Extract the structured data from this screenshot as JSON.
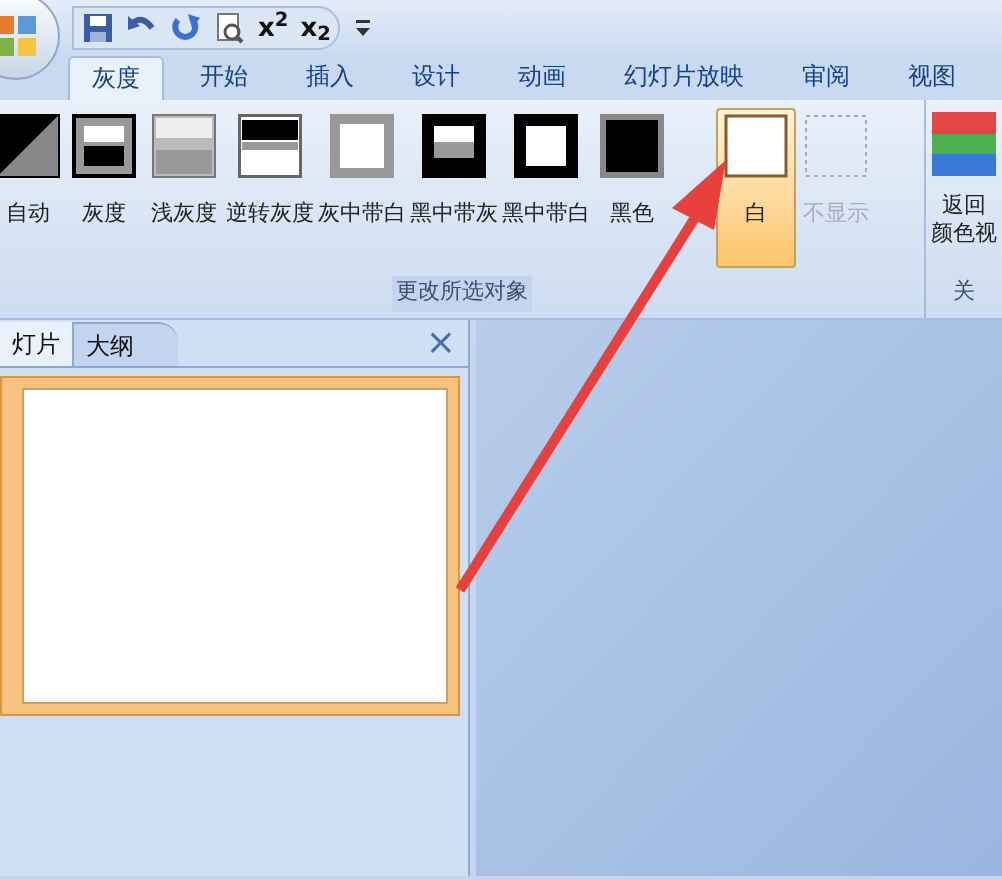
{
  "quick_access": [
    {
      "kind": "save"
    },
    {
      "kind": "undo"
    },
    {
      "kind": "redo"
    },
    {
      "kind": "preview"
    },
    {
      "kind": "text",
      "label": "x$^{2}$"
    },
    {
      "kind": "text",
      "label": "x$_{2}$"
    }
  ],
  "tabs": [
    {
      "label": "灰度",
      "selected": true
    },
    {
      "label": "开始",
      "selected": false
    },
    {
      "label": "插入",
      "selected": false
    },
    {
      "label": "设计",
      "selected": false
    },
    {
      "label": "动画",
      "selected": false
    },
    {
      "label": "幻灯片放映",
      "selected": false
    },
    {
      "label": "审阅",
      "selected": false
    },
    {
      "label": "视图",
      "selected": false
    }
  ],
  "ribbon": {
    "group_label": "更改所选对象",
    "buttons": [
      {
        "kind": "auto",
        "label": "自动",
        "selected": false,
        "disabled": false
      },
      {
        "kind": "grayscale",
        "label": "灰度",
        "selected": false,
        "disabled": false
      },
      {
        "kind": "light",
        "label": "浅灰度",
        "selected": false,
        "disabled": false
      },
      {
        "kind": "inverse",
        "label": "逆转灰度",
        "selected": false,
        "disabled": false
      },
      {
        "kind": "gray_white",
        "label": "灰中带白",
        "selected": false,
        "disabled": false
      },
      {
        "kind": "black_gray",
        "label": "黑中带灰",
        "selected": false,
        "disabled": false
      },
      {
        "kind": "black_white",
        "label": "黑中带白",
        "selected": false,
        "disabled": false
      },
      {
        "kind": "black",
        "label": "黑色",
        "selected": false,
        "disabled": false
      },
      {
        "kind": "white",
        "label": "白",
        "selected": true,
        "disabled": false
      },
      {
        "kind": "none",
        "label": "不显示",
        "selected": false,
        "disabled": true
      }
    ],
    "close_group": {
      "button_lines": [
        "返回",
        "颜色视"
      ],
      "group_label": "关"
    }
  },
  "pane": {
    "tabs": [
      {
        "label": "灯片",
        "selected": true
      },
      {
        "label": "大纲",
        "selected": false
      }
    ],
    "close": "×"
  }
}
